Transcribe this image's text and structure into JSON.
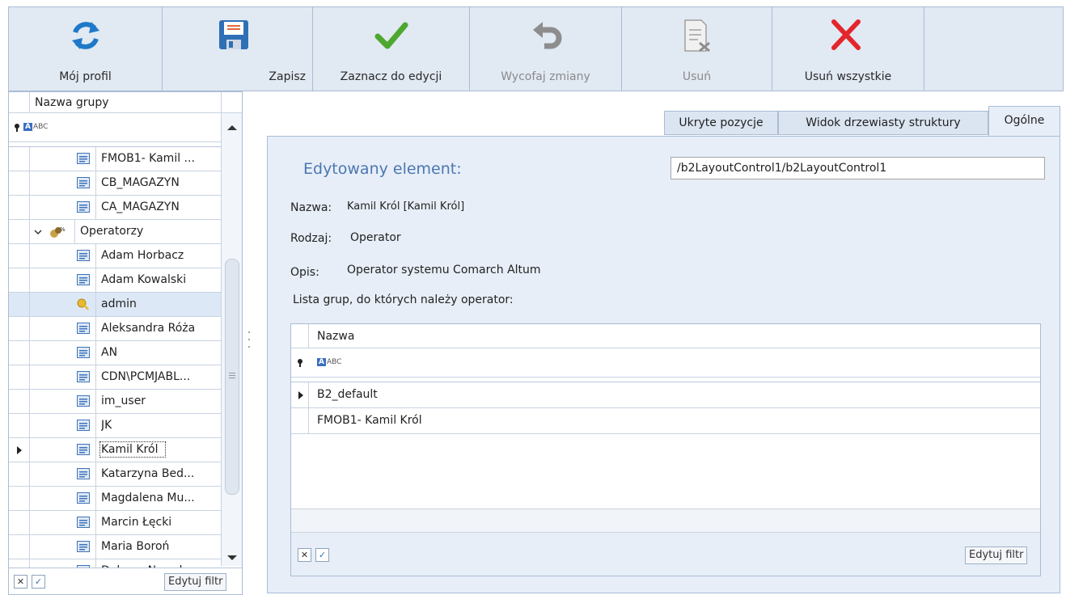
{
  "toolbar": {
    "buttons": [
      {
        "label": "Mój profil",
        "icon": "refresh-icon",
        "enabled": true
      },
      {
        "label": "Zapisz",
        "icon": "save-icon",
        "enabled": true
      },
      {
        "label": "Zaznacz do edycji",
        "icon": "checkmark-icon",
        "enabled": true
      },
      {
        "label": "Wycofaj zmiany",
        "icon": "undo-icon",
        "enabled": false
      },
      {
        "label": "Usuń",
        "icon": "delete-document-icon",
        "enabled": false
      },
      {
        "label": "Usuń wszystkie",
        "icon": "red-x-icon",
        "enabled": true
      }
    ]
  },
  "left_grid": {
    "header": "Nazwa grupy",
    "filter_placeholder": "ABC",
    "rows": [
      {
        "label": "FMOB1- Kamil ...",
        "icon": "list-icon"
      },
      {
        "label": "CB_MAGAZYN",
        "icon": "list-icon"
      },
      {
        "label": "CA_MAGAZYN",
        "icon": "list-icon"
      },
      {
        "label": "Operatorzy",
        "icon": "users-group-icon",
        "group": true
      },
      {
        "label": "Adam Horbacz",
        "icon": "list-icon"
      },
      {
        "label": "Adam Kowalski",
        "icon": "list-icon"
      },
      {
        "label": "admin",
        "icon": "key-icon",
        "selected": true
      },
      {
        "label": "Aleksandra Róża",
        "icon": "list-icon"
      },
      {
        "label": "AN",
        "icon": "list-icon"
      },
      {
        "label": "CDN\\PCMJABL...",
        "icon": "list-icon"
      },
      {
        "label": "im_user",
        "icon": "list-icon"
      },
      {
        "label": "JK",
        "icon": "list-icon"
      },
      {
        "label": "Kamil Król",
        "icon": "list-icon",
        "current": true
      },
      {
        "label": "Katarzyna Bed...",
        "icon": "list-icon"
      },
      {
        "label": "Magdalena Mu...",
        "icon": "list-icon"
      },
      {
        "label": "Marcin Łęcki",
        "icon": "list-icon"
      },
      {
        "label": "Maria Boroń",
        "icon": "list-icon"
      },
      {
        "label": "Dolores Nowak",
        "icon": "list-icon"
      }
    ],
    "filter_button": "Edytuj filtr"
  },
  "tabs": [
    {
      "label": "Ukryte pozycje",
      "active": false
    },
    {
      "label": "Widok drzewiasty struktury",
      "active": false
    },
    {
      "label": "Ogólne",
      "active": true
    }
  ],
  "details": {
    "title": "Edytowany element:",
    "path": "/b2LayoutControl1/b2LayoutControl1",
    "name_label": "Nazwa:",
    "name_value": "Kamil Król [Kamil Król]",
    "type_label": "Rodzaj:",
    "type_value": "Operator",
    "desc_label": "Opis:",
    "desc_value": "Operator systemu Comarch Altum",
    "groups_label": "Lista grup, do których należy operator:"
  },
  "inner_grid": {
    "header": "Nazwa",
    "filter_placeholder": "ABC",
    "rows": [
      "B2_default",
      "FMOB1- Kamil Król"
    ],
    "filter_button": "Edytuj filtr"
  }
}
